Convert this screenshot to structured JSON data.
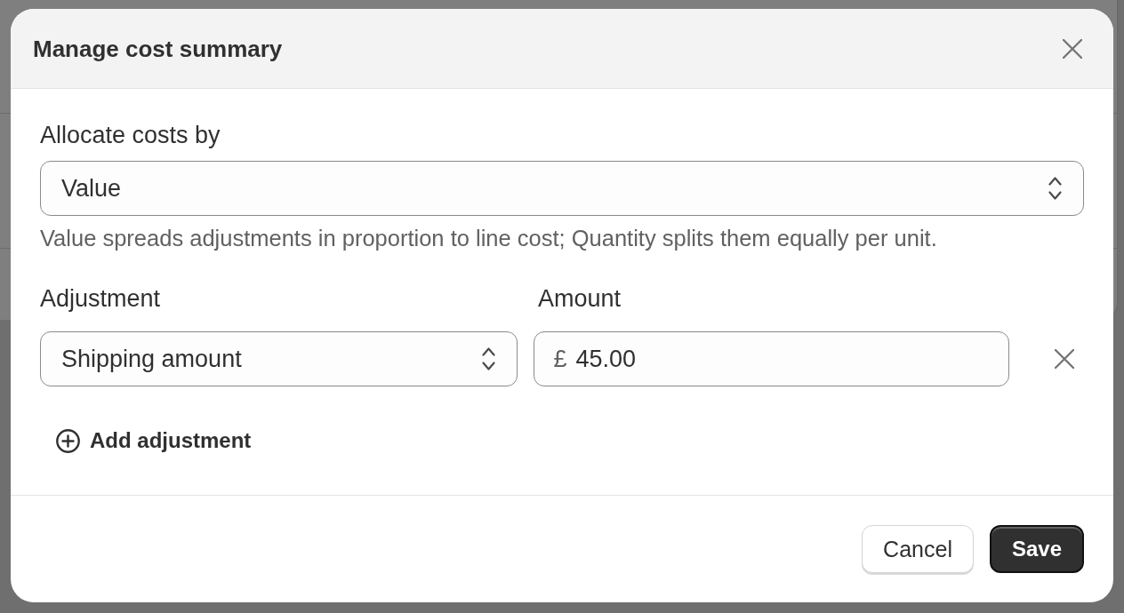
{
  "dialog": {
    "title": "Manage cost summary",
    "allocation": {
      "label": "Allocate costs by",
      "value": "Value",
      "help": "Value spreads adjustments in proportion to line cost; Quantity splits them equally per unit."
    },
    "adjustments": {
      "columns": [
        "Adjustment",
        "Amount"
      ],
      "rows": [
        {
          "type": "Shipping amount",
          "currency": "£",
          "amount": "45.00"
        }
      ]
    },
    "add_button": "Add adjustment",
    "buttons": [
      {
        "label": "Cancel",
        "kind": "secondary"
      },
      {
        "label": "Save",
        "kind": "primary"
      }
    ]
  }
}
